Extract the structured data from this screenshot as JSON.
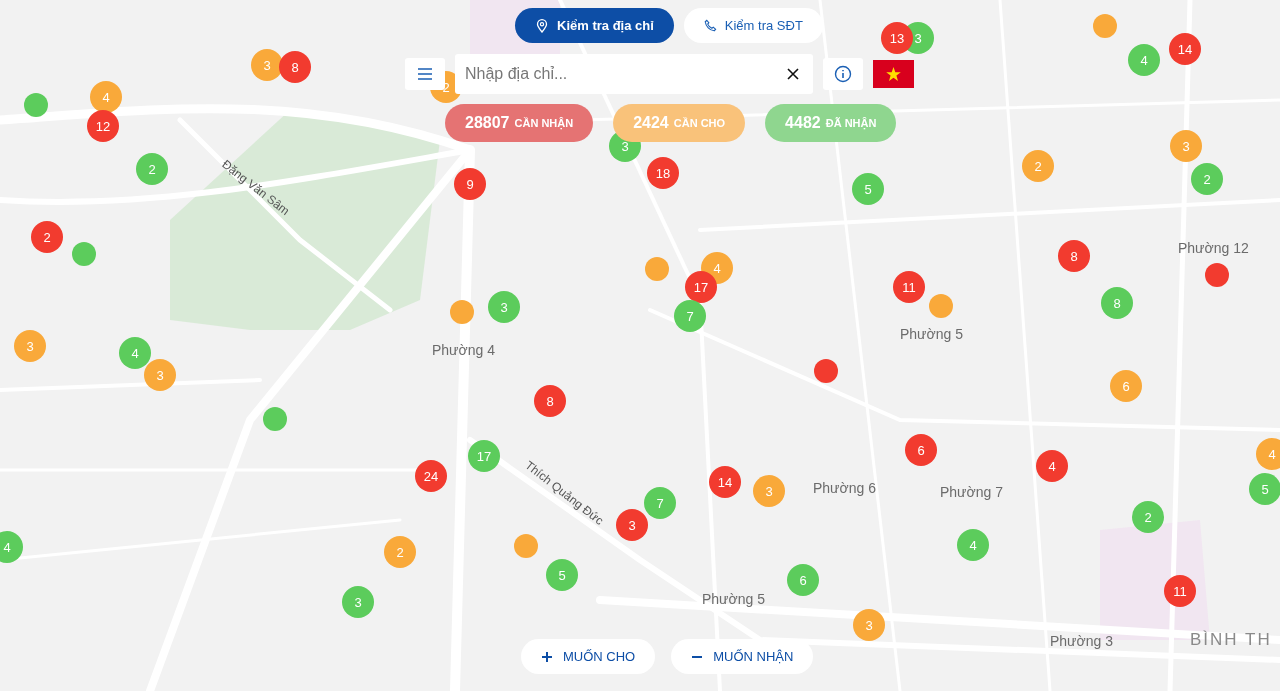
{
  "check_tabs": [
    {
      "label": "Kiểm tra địa chỉ",
      "kind": "address",
      "selected": true
    },
    {
      "label": "Kiểm tra SĐT",
      "kind": "phone",
      "selected": false
    }
  ],
  "search": {
    "placeholder": "Nhập địa chỉ..."
  },
  "stats": [
    {
      "count": "28807",
      "label": "CẦN NHẬN",
      "color": "#e57373"
    },
    {
      "count": "2424",
      "label": "CẦN CHO",
      "color": "#f9c27a"
    },
    {
      "count": "4482",
      "label": "ĐÃ NHẬN",
      "color": "#8fd68f"
    }
  ],
  "map_labels": [
    {
      "text": "Đặng Văn Sâm",
      "kind": "street"
    },
    {
      "text": "Thích Quảng Đức",
      "kind": "street"
    },
    {
      "text": "Phường 4",
      "kind": "area"
    },
    {
      "text": "Phường 12",
      "kind": "area"
    },
    {
      "text": "Phường 5",
      "kind": "area"
    },
    {
      "text": "Phường 6",
      "kind": "area"
    },
    {
      "text": "Phường 7",
      "kind": "area"
    },
    {
      "text": "Phường 5",
      "kind": "area"
    },
    {
      "text": "Phường 3",
      "kind": "area"
    },
    {
      "text": "BÌNH TH",
      "kind": "district"
    }
  ],
  "markers": [
    {
      "count": "3",
      "color": "#f9a93a"
    },
    {
      "count": "8",
      "color": "#f23b2f"
    },
    {
      "count": "4",
      "color": "#f9a93a"
    },
    {
      "color": "#5ccc5c"
    },
    {
      "count": "12",
      "color": "#f23b2f"
    },
    {
      "count": "2",
      "color": "#5ccc5c"
    },
    {
      "count": "2",
      "color": "#f23b2f"
    },
    {
      "color": "#5ccc5c"
    },
    {
      "count": "3",
      "color": "#f9a93a"
    },
    {
      "count": "4",
      "color": "#5ccc5c"
    },
    {
      "count": "3",
      "color": "#f9a93a"
    },
    {
      "color": "#5ccc5c"
    },
    {
      "count": "4",
      "color": "#5ccc5c"
    },
    {
      "count": "2",
      "color": "#f9a93a"
    },
    {
      "count": "3",
      "color": "#5ccc5c"
    },
    {
      "count": "24",
      "color": "#f23b2f"
    },
    {
      "count": "17",
      "color": "#5ccc5c"
    },
    {
      "color": "#f9a93a"
    },
    {
      "count": "3",
      "color": "#5ccc5c"
    },
    {
      "count": "8",
      "color": "#f23b2f"
    },
    {
      "count": "9",
      "color": "#f23b2f"
    },
    {
      "count": "3",
      "color": "#5ccc5c"
    },
    {
      "count": "18",
      "color": "#f23b2f"
    },
    {
      "color": "#f9a93a"
    },
    {
      "count": "4",
      "color": "#f9a93a"
    },
    {
      "count": "17",
      "color": "#f23b2f"
    },
    {
      "count": "7",
      "color": "#5ccc5c"
    },
    {
      "count": "3",
      "color": "#5ccc5c"
    },
    {
      "count": "13",
      "color": "#f23b2f"
    },
    {
      "color": "#f9a93a"
    },
    {
      "count": "4",
      "color": "#5ccc5c"
    },
    {
      "count": "14",
      "color": "#f23b2f"
    },
    {
      "count": "2",
      "color": "#f9a93a"
    },
    {
      "count": "3",
      "color": "#f9a93a"
    },
    {
      "count": "2",
      "color": "#5ccc5c"
    },
    {
      "count": "5",
      "color": "#5ccc5c"
    },
    {
      "count": "8",
      "color": "#f23b2f"
    },
    {
      "count": "11",
      "color": "#f23b2f"
    },
    {
      "color": "#f9a93a"
    },
    {
      "count": "8",
      "color": "#5ccc5c"
    },
    {
      "color": "#f23b2f"
    },
    {
      "color": "#f23b2f"
    },
    {
      "count": "6",
      "color": "#f9a93a"
    },
    {
      "count": "6",
      "color": "#f23b2f"
    },
    {
      "count": "4",
      "color": "#f23b2f"
    },
    {
      "count": "4",
      "color": "#f9a93a"
    },
    {
      "count": "5",
      "color": "#5ccc5c"
    },
    {
      "count": "14",
      "color": "#f23b2f"
    },
    {
      "count": "3",
      "color": "#f9a93a"
    },
    {
      "count": "7",
      "color": "#5ccc5c"
    },
    {
      "count": "3",
      "color": "#f23b2f"
    },
    {
      "color": "#f9a93a"
    },
    {
      "count": "5",
      "color": "#5ccc5c"
    },
    {
      "count": "6",
      "color": "#5ccc5c"
    },
    {
      "count": "4",
      "color": "#5ccc5c"
    },
    {
      "count": "2",
      "color": "#5ccc5c"
    },
    {
      "count": "11",
      "color": "#f23b2f"
    },
    {
      "count": "3",
      "color": "#f9a93a"
    },
    {
      "count": "2",
      "color": "#f9a93a"
    }
  ],
  "actions": [
    {
      "label": "MUỐN CHO",
      "kind": "give"
    },
    {
      "label": "MUỐN NHẬN",
      "kind": "receive"
    }
  ]
}
